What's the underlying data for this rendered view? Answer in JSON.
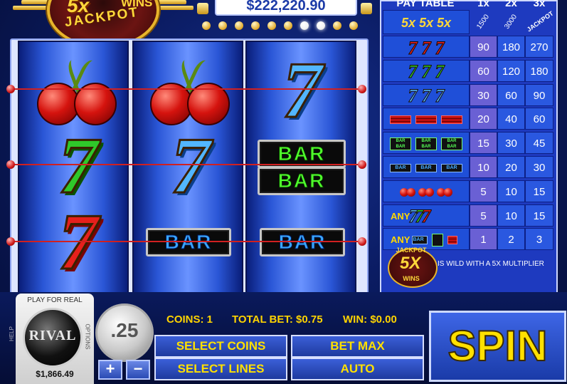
{
  "header": {
    "logo_5x": "5x",
    "logo_wins": "WINS",
    "logo_jackpot": "JACKPOT",
    "jackpot_amount": "$222,220.90"
  },
  "reels": [
    [
      "cherry",
      "seven-green",
      "seven-red"
    ],
    [
      "cherry",
      "seven-blue",
      "bar-blue"
    ],
    [
      "seven-blue",
      "double-bar-green",
      "bar-blue"
    ]
  ],
  "symbols": {
    "seven": "7",
    "bar": "BAR"
  },
  "paytable": {
    "title": "PAY TABLE",
    "columns": [
      "1x",
      "2x",
      "3x"
    ],
    "top_row": {
      "label": "5x 5x 5x",
      "c1": "1500",
      "c2": "3000",
      "c3": "JACKPOT"
    },
    "rows": [
      {
        "symbol": "three red sevens",
        "c1": "90",
        "c2": "180",
        "c3": "270"
      },
      {
        "symbol": "three green sevens",
        "c1": "60",
        "c2": "120",
        "c3": "180"
      },
      {
        "symbol": "three blue sevens",
        "c1": "30",
        "c2": "60",
        "c3": "90"
      },
      {
        "symbol": "three red bars",
        "c1": "20",
        "c2": "40",
        "c3": "60"
      },
      {
        "symbol": "three green bars",
        "c1": "15",
        "c2": "30",
        "c3": "45"
      },
      {
        "symbol": "three blue bars",
        "c1": "10",
        "c2": "20",
        "c3": "30"
      },
      {
        "symbol": "three cherries",
        "c1": "5",
        "c2": "10",
        "c3": "15"
      },
      {
        "symbol": "any sevens",
        "c1": "5",
        "c2": "10",
        "c3": "15"
      },
      {
        "symbol": "any bars",
        "c1": "1",
        "c2": "2",
        "c3": "3"
      }
    ],
    "any_label": "ANY",
    "wild_jackpot": "JACKPOT",
    "wild_5x": "5X",
    "wild_wins": "WINS",
    "wild_note": "IS WILD WITH A 5X MULTIPLIER"
  },
  "controls": {
    "play_for_real": "PLAY FOR REAL",
    "rival": "RIVAL",
    "balance": "$1,866.49",
    "help": "HELP",
    "options": "OPTIONS",
    "coin_value": ".25",
    "plus": "+",
    "minus": "−",
    "coins": "COINS: 1",
    "total_bet": "TOTAL BET: $0.75",
    "win": "WIN: $0.00",
    "select_coins": "SELECT COINS",
    "bet_max": "BET MAX",
    "select_lines": "SELECT LINES",
    "auto": "AUTO",
    "spin": "SPIN"
  }
}
